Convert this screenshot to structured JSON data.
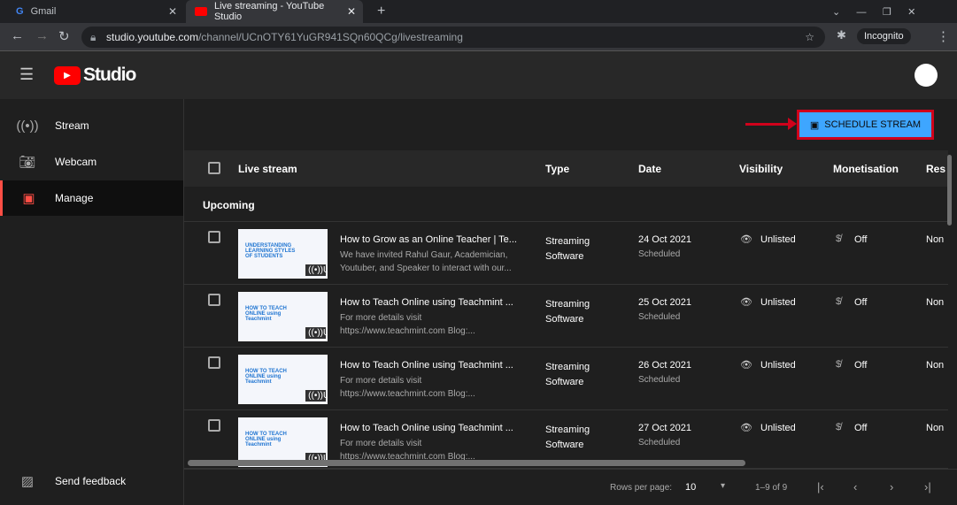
{
  "browser": {
    "tabs": [
      {
        "label": "Gmail",
        "icon": "google-icon"
      },
      {
        "label": "Live streaming - YouTube Studio",
        "icon": "youtube-icon"
      }
    ],
    "url_host": "studio.youtube.com",
    "url_path": "/channel/UCnOTY61YuGR941SQn60QCg/livestreaming",
    "incognito": "Incognito"
  },
  "app": {
    "logo": "Studio"
  },
  "sidebar": {
    "items": [
      {
        "label": "Stream",
        "icon": "broadcast-icon"
      },
      {
        "label": "Webcam",
        "icon": "camera-icon"
      },
      {
        "label": "Manage",
        "icon": "calendar-icon"
      }
    ],
    "feedback": "Send feedback"
  },
  "toolbar": {
    "schedule_label": "SCHEDULE STREAM"
  },
  "table": {
    "columns": [
      "Live stream",
      "Type",
      "Date",
      "Visibility",
      "Monetisation",
      "Res"
    ],
    "section": "Upcoming",
    "rows": [
      {
        "thumb_text": "UNDERSTANDING LEARNING STYLES OF STUDENTS",
        "badge": "Upcoming",
        "title": "How to Grow as an Online Teacher | Te...",
        "desc": "We have invited Rahul Gaur, Academician, Youtuber, and Speaker to interact with our...",
        "type1": "Streaming",
        "type2": "Software",
        "date": "24 Oct 2021",
        "status": "Scheduled",
        "visibility": "Unlisted",
        "monetisation": "Off",
        "res": "Non"
      },
      {
        "thumb_text": "HOW TO TEACH ONLINE using Teachmint",
        "badge": "Upcoming",
        "title": "How to Teach Online using Teachmint ...",
        "desc": "For more details visit https://www.teachmint.com Blog:...",
        "type1": "Streaming",
        "type2": "Software",
        "date": "25 Oct 2021",
        "status": "Scheduled",
        "visibility": "Unlisted",
        "monetisation": "Off",
        "res": "Non"
      },
      {
        "thumb_text": "HOW TO TEACH ONLINE using Teachmint",
        "badge": "Upcoming",
        "title": "How to Teach Online using Teachmint ...",
        "desc": "For more details visit https://www.teachmint.com Blog:...",
        "type1": "Streaming",
        "type2": "Software",
        "date": "26 Oct 2021",
        "status": "Scheduled",
        "visibility": "Unlisted",
        "monetisation": "Off",
        "res": "Non"
      },
      {
        "thumb_text": "HOW TO TEACH ONLINE using Teachmint",
        "badge": "Upcoming",
        "title": "How to Teach Online using Teachmint ...",
        "desc": "For more details visit https://www.teachmint.com Blog:...",
        "type1": "Streaming",
        "type2": "Software",
        "date": "27 Oct 2021",
        "status": "Scheduled",
        "visibility": "Unlisted",
        "monetisation": "Off",
        "res": "Non"
      }
    ]
  },
  "pagination": {
    "rows_label": "Rows per page:",
    "rows_value": "10",
    "range": "1–9 of 9"
  },
  "colors": {
    "accent": "#3ea6ff",
    "highlight": "#d0021b",
    "active_bar": "#ff4e45"
  }
}
